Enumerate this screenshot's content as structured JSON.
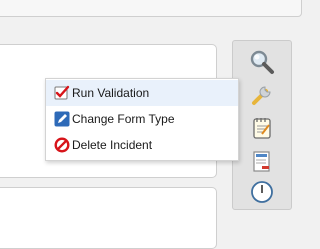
{
  "context_menu": {
    "items": [
      {
        "label": "Run Validation",
        "icon": "validation-check-icon"
      },
      {
        "label": "Change Form Type",
        "icon": "edit-pencil-icon"
      },
      {
        "label": "Delete Incident",
        "icon": "delete-no-icon"
      }
    ]
  },
  "toolbar": {
    "tools": [
      {
        "icon": "search-magnifier-icon"
      },
      {
        "icon": "wrench-icon"
      },
      {
        "icon": "notepad-icon"
      },
      {
        "icon": "report-icon"
      },
      {
        "icon": "clock-icon"
      }
    ]
  },
  "colors": {
    "menu_hover": "#e9f1fb",
    "delete_red": "#d7141a",
    "edit_blue": "#2e6ab8"
  }
}
